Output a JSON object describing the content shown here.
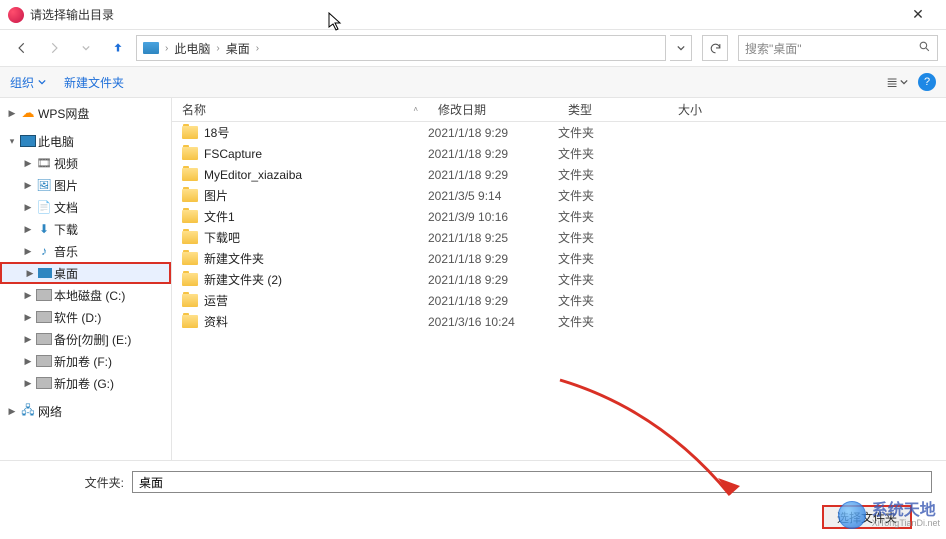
{
  "window": {
    "title": "请选择输出目录",
    "close": "✕"
  },
  "nav": {
    "breadcrumb": {
      "pc": "此电脑",
      "desktop": "桌面",
      "sep": "›"
    },
    "search_placeholder": "搜索\"桌面\""
  },
  "toolbar": {
    "organize": "组织",
    "new_folder": "新建文件夹",
    "view_glyph": "≣",
    "help": "?"
  },
  "sidebar": {
    "wps": "WPS网盘",
    "pc": "此电脑",
    "video": "视频",
    "pictures": "图片",
    "documents": "文档",
    "downloads": "下载",
    "music": "音乐",
    "desktop": "桌面",
    "disk_c": "本地磁盘 (C:)",
    "disk_d": "软件 (D:)",
    "disk_e": "备份[勿删] (E:)",
    "disk_f": "新加卷 (F:)",
    "disk_g": "新加卷 (G:)",
    "network": "网络"
  },
  "columns": {
    "name": "名称",
    "date": "修改日期",
    "type": "类型",
    "size": "大小"
  },
  "type_folder": "文件夹",
  "files": [
    {
      "name": "18号",
      "date": "2021/1/18 9:29"
    },
    {
      "name": "FSCapture",
      "date": "2021/1/18 9:29"
    },
    {
      "name": "MyEditor_xiazaiba",
      "date": "2021/1/18 9:29"
    },
    {
      "name": "图片",
      "date": "2021/3/5 9:14"
    },
    {
      "name": "文件1",
      "date": "2021/3/9 10:16"
    },
    {
      "name": "下载吧",
      "date": "2021/1/18 9:25"
    },
    {
      "name": "新建文件夹",
      "date": "2021/1/18 9:29"
    },
    {
      "name": "新建文件夹 (2)",
      "date": "2021/1/18 9:29"
    },
    {
      "name": "运营",
      "date": "2021/1/18 9:29"
    },
    {
      "name": "资料",
      "date": "2021/3/16 10:24"
    }
  ],
  "footer": {
    "folder_label": "文件夹:",
    "folder_value": "桌面",
    "select": "选择文件夹"
  },
  "watermark": {
    "big": "系统天地",
    "small": "XiTongTianDi.net"
  }
}
